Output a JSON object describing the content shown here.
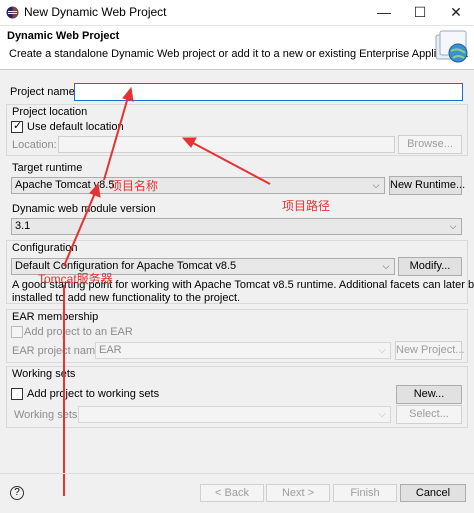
{
  "window": {
    "title": "New Dynamic Web Project",
    "minimize": "—",
    "maximize": "☐",
    "close": "✕"
  },
  "header": {
    "title": "Dynamic Web Project",
    "description": "Create a standalone Dynamic Web project or add it to a new or existing Enterprise Application."
  },
  "project_name": {
    "label": "Project name:",
    "value": ""
  },
  "project_location": {
    "group_label": "Project location",
    "use_default_label": "Use default location",
    "use_default_checked": true,
    "location_label": "Location:",
    "location_value": "",
    "browse_label": "Browse..."
  },
  "target_runtime": {
    "group_label": "Target runtime",
    "selected": "Apache Tomcat v8.5",
    "new_runtime_label": "New Runtime..."
  },
  "module_version": {
    "group_label": "Dynamic web module version",
    "selected": "3.1"
  },
  "configuration": {
    "group_label": "Configuration",
    "selected": "Default Configuration for Apache Tomcat v8.5",
    "modify_label": "Modify...",
    "description_line1": "A good starting point for working with Apache Tomcat v8.5 runtime. Additional facets can later be",
    "description_line2": "installed to add new functionality to the project."
  },
  "ear_membership": {
    "group_label": "EAR membership",
    "add_to_ear_label": "Add project to an EAR",
    "add_to_ear_checked": false,
    "ear_project_name_label": "EAR project name:",
    "ear_project_name_value": "EAR",
    "new_project_label": "New Project..."
  },
  "working_sets": {
    "group_label": "Working sets",
    "add_label": "Add project to working sets",
    "add_checked": false,
    "new_label": "New...",
    "working_sets_label": "Working sets:",
    "working_sets_value": "",
    "select_label": "Select..."
  },
  "annotations": {
    "project_name": "项目名称",
    "project_path": "项目路径",
    "tomcat_server": "Tomcat服务器",
    "color": "#e53232"
  },
  "footer": {
    "help": "?",
    "back_label": "< Back",
    "next_label": "Next >",
    "finish_label": "Finish",
    "cancel_label": "Cancel"
  }
}
